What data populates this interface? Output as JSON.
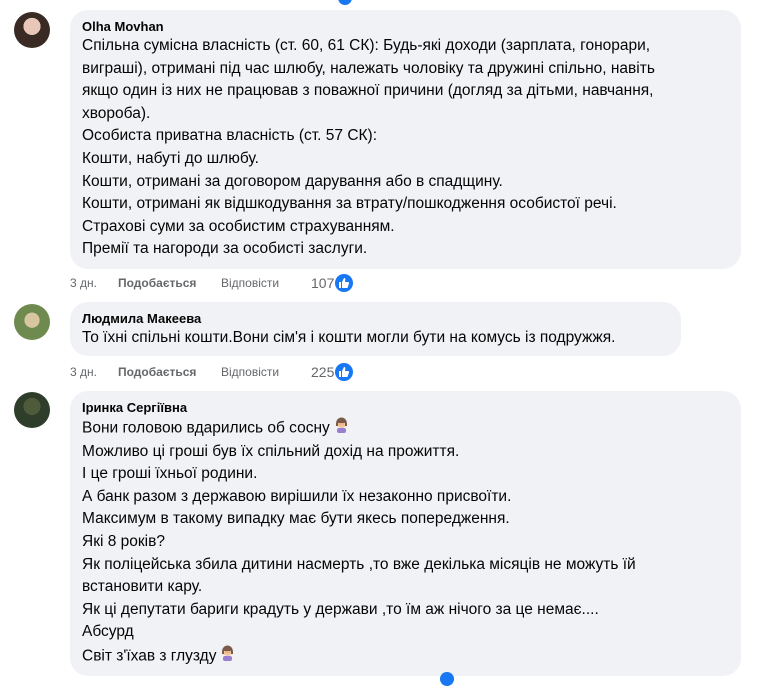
{
  "comments": [
    {
      "author": "Olha Movhan",
      "lines": [
        "Спільна сумісна власність (ст. 60, 61 СК): Будь-які доходи (зарплата, гонорари,",
        "виграші), отримані під час шлюбу, належать чоловіку та дружині спільно, навіть",
        "якщо один із них не працював з поважної причини (догляд за дітьми, навчання,",
        "хвороба).",
        "Особиста приватна власність (ст. 57 СК):",
        "Кошти, набуті до шлюбу.",
        "Кошти, отримані за договором дарування або в спадщину.",
        "Кошти, отримані як відшкодування за втрату/пошкодження особистої речі.",
        "Страхові суми за особистим страхуванням.",
        "Премії та нагороди за особисті заслуги."
      ],
      "time": "3 дн.",
      "like_label": "Подобається",
      "reply_label": "Відповісти",
      "reactions": "107"
    },
    {
      "author": "Людмила Макеева",
      "lines": [
        "То їхні спільні кошти.Вони сім'я і кошти могли бути на комусь із подружжя."
      ],
      "time": "3 дн.",
      "like_label": "Подобається",
      "reply_label": "Відповісти",
      "reactions": "225"
    },
    {
      "author": "Іринка Сергіївна",
      "lines": [
        "Вони головою вдарились об сосну",
        "Можливо ці гроші був їх спільний дохід на прожиття.",
        "І це гроші їхньої родини.",
        "А банк разом з державою вирішили їх незаконно присвоїти.",
        "Максимум в такому випадку має бути якесь попередження.",
        "Які 8 років?",
        "Як поліцейська збила дитини насмерть ,то вже декілька місяців не можуть їй",
        "встановити кару.",
        "Як ці депутати бариги крадуть у держави ,то їм аж нічого за це немає....",
        "Абсурд",
        "Світ з'їхав з глузду"
      ],
      "time": "",
      "like_label": "",
      "reply_label": "",
      "reactions": ""
    }
  ],
  "colors": {
    "accent": "#1877f2",
    "bubble": "#f0f2f5",
    "meta": "#65676b"
  },
  "icons": {
    "reaction": "thumbs-up-icon",
    "emoji": "woman-facepalming-icon"
  }
}
